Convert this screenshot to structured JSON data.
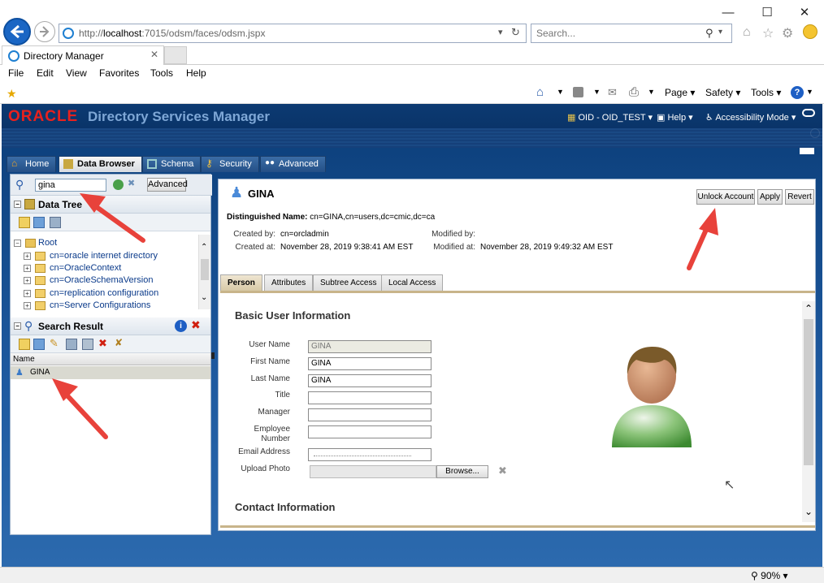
{
  "browser": {
    "url_prefix": "http://",
    "url_host": "localhost",
    "url_rest": ":7015/odsm/faces/odsm.jspx",
    "search_placeholder": "Search...",
    "tab_title": "Directory Manager",
    "menu": [
      "File",
      "Edit",
      "View",
      "Favorites",
      "Tools",
      "Help"
    ],
    "commands": {
      "page": "Page",
      "safety": "Safety",
      "tools": "Tools"
    },
    "zoom": "90%"
  },
  "odsm": {
    "brand": "ORACLE",
    "product": "Directory Services Manager",
    "header_links": {
      "connection": "OID - OID_TEST",
      "help": "Help",
      "accessibility": "Accessibility Mode"
    },
    "tabs": [
      "Home",
      "Data Browser",
      "Schema",
      "Security",
      "Advanced"
    ],
    "active_tab": "Data Browser"
  },
  "left": {
    "search_value": "gina",
    "advanced_label": "Advanced",
    "data_tree_title": "Data Tree",
    "tree": {
      "root": "Root",
      "items": [
        "cn=oracle internet directory",
        "cn=OracleContext",
        "cn=OracleSchemaVersion",
        "cn=replication configuration",
        "cn=Server Configurations"
      ]
    },
    "search_result_title": "Search Result",
    "result_column": "Name",
    "results": [
      "GINA"
    ]
  },
  "entry": {
    "title": "GINA",
    "buttons": {
      "unlock": "Unlock Account",
      "apply": "Apply",
      "revert": "Revert"
    },
    "dn_label": "Distinguished Name:",
    "dn_value": "cn=GINA,cn=users,dc=cmic,dc=ca",
    "created_by_label": "Created by:",
    "created_by": "cn=orcladmin",
    "created_at_label": "Created at:",
    "created_at": "November 28, 2019 9:38:41 AM EST",
    "modified_by_label": "Modified by:",
    "modified_by": "",
    "modified_at_label": "Modified at:",
    "modified_at": "November 28, 2019 9:49:32 AM EST",
    "tabs": [
      "Person",
      "Attributes",
      "Subtree Access",
      "Local Access"
    ],
    "active_tab": "Person",
    "section_basic": "Basic User Information",
    "fields": {
      "user_name": {
        "label": "User Name",
        "value": "GINA"
      },
      "first_name": {
        "label": "First Name",
        "value": "GINA"
      },
      "last_name": {
        "label": "Last Name",
        "value": "GINA"
      },
      "title": {
        "label": "Title",
        "value": ""
      },
      "manager": {
        "label": "Manager",
        "value": ""
      },
      "employee_number": {
        "label": "Employee\nNumber",
        "value": ""
      },
      "email": {
        "label": "Email Address",
        "value": ""
      },
      "upload_photo": {
        "label": "Upload Photo",
        "browse": "Browse..."
      }
    },
    "section_contact": "Contact Information"
  },
  "colors": {
    "annotation_arrow": "#e8423b",
    "oracle_red": "#e8211d",
    "link_blue": "#0a3a8a"
  }
}
